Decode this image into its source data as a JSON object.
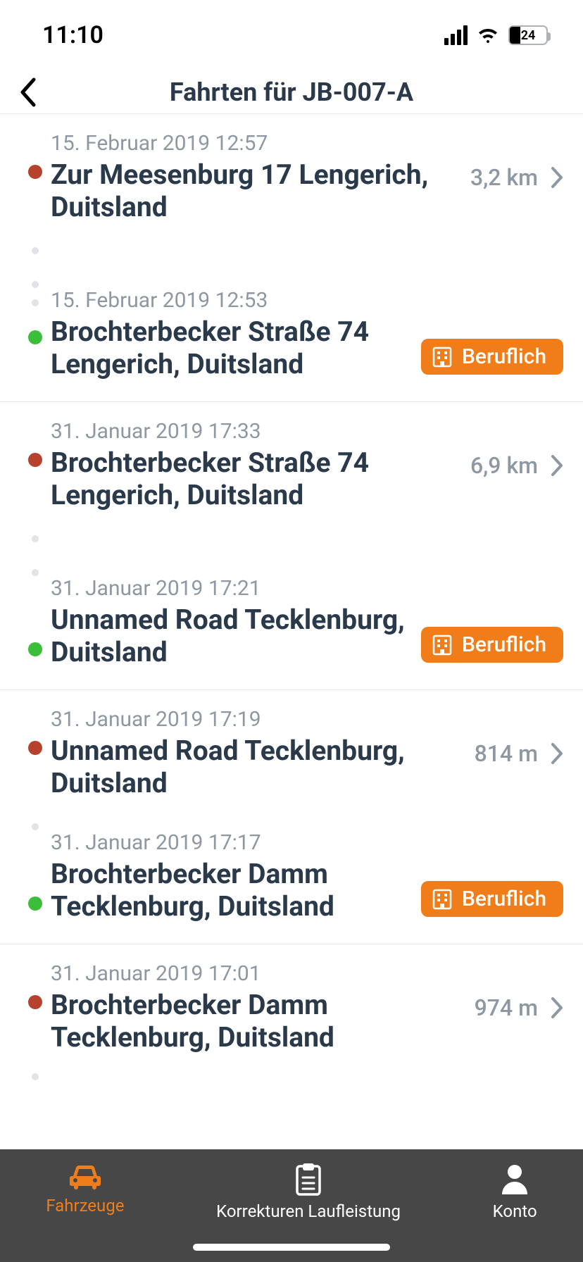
{
  "status": {
    "time": "11:10",
    "battery_pct": "24"
  },
  "header": {
    "title": "Fahrten für JB-007-A"
  },
  "trip_groups": [
    {
      "start": {
        "timestamp": "15. Februar 2019 12:57",
        "address": "Zur Meesenburg 17 Lengerich, Duitsland"
      },
      "end": {
        "timestamp": "15. Februar 2019 12:53",
        "address": "Brochterbecker Straße 74 Lengerich, Duitsland"
      },
      "distance": "3,2 km",
      "category_label": "Beruflich"
    },
    {
      "start": {
        "timestamp": "31. Januar 2019 17:33",
        "address": "Brochterbecker Straße 74 Lengerich, Duitsland"
      },
      "end": {
        "timestamp": "31. Januar 2019 17:21",
        "address": "Unnamed Road Tecklenburg, Duitsland"
      },
      "distance": "6,9 km",
      "category_label": "Beruflich"
    },
    {
      "start": {
        "timestamp": "31. Januar 2019 17:19",
        "address": "Unnamed Road Tecklenburg, Duitsland"
      },
      "end": {
        "timestamp": "31. Januar 2019 17:17",
        "address": "Brochterbecker Damm Tecklenburg, Duitsland"
      },
      "distance": "814 m",
      "category_label": "Beruflich"
    },
    {
      "start": {
        "timestamp": "31. Januar 2019 17:01",
        "address": "Brochterbecker Damm Tecklenburg, Duitsland"
      },
      "distance": "974 m"
    }
  ],
  "tabbar": {
    "items": [
      {
        "label": "Fahrzeuge"
      },
      {
        "label": "Korrekturen Laufleistung"
      },
      {
        "label": "Konto"
      }
    ]
  }
}
